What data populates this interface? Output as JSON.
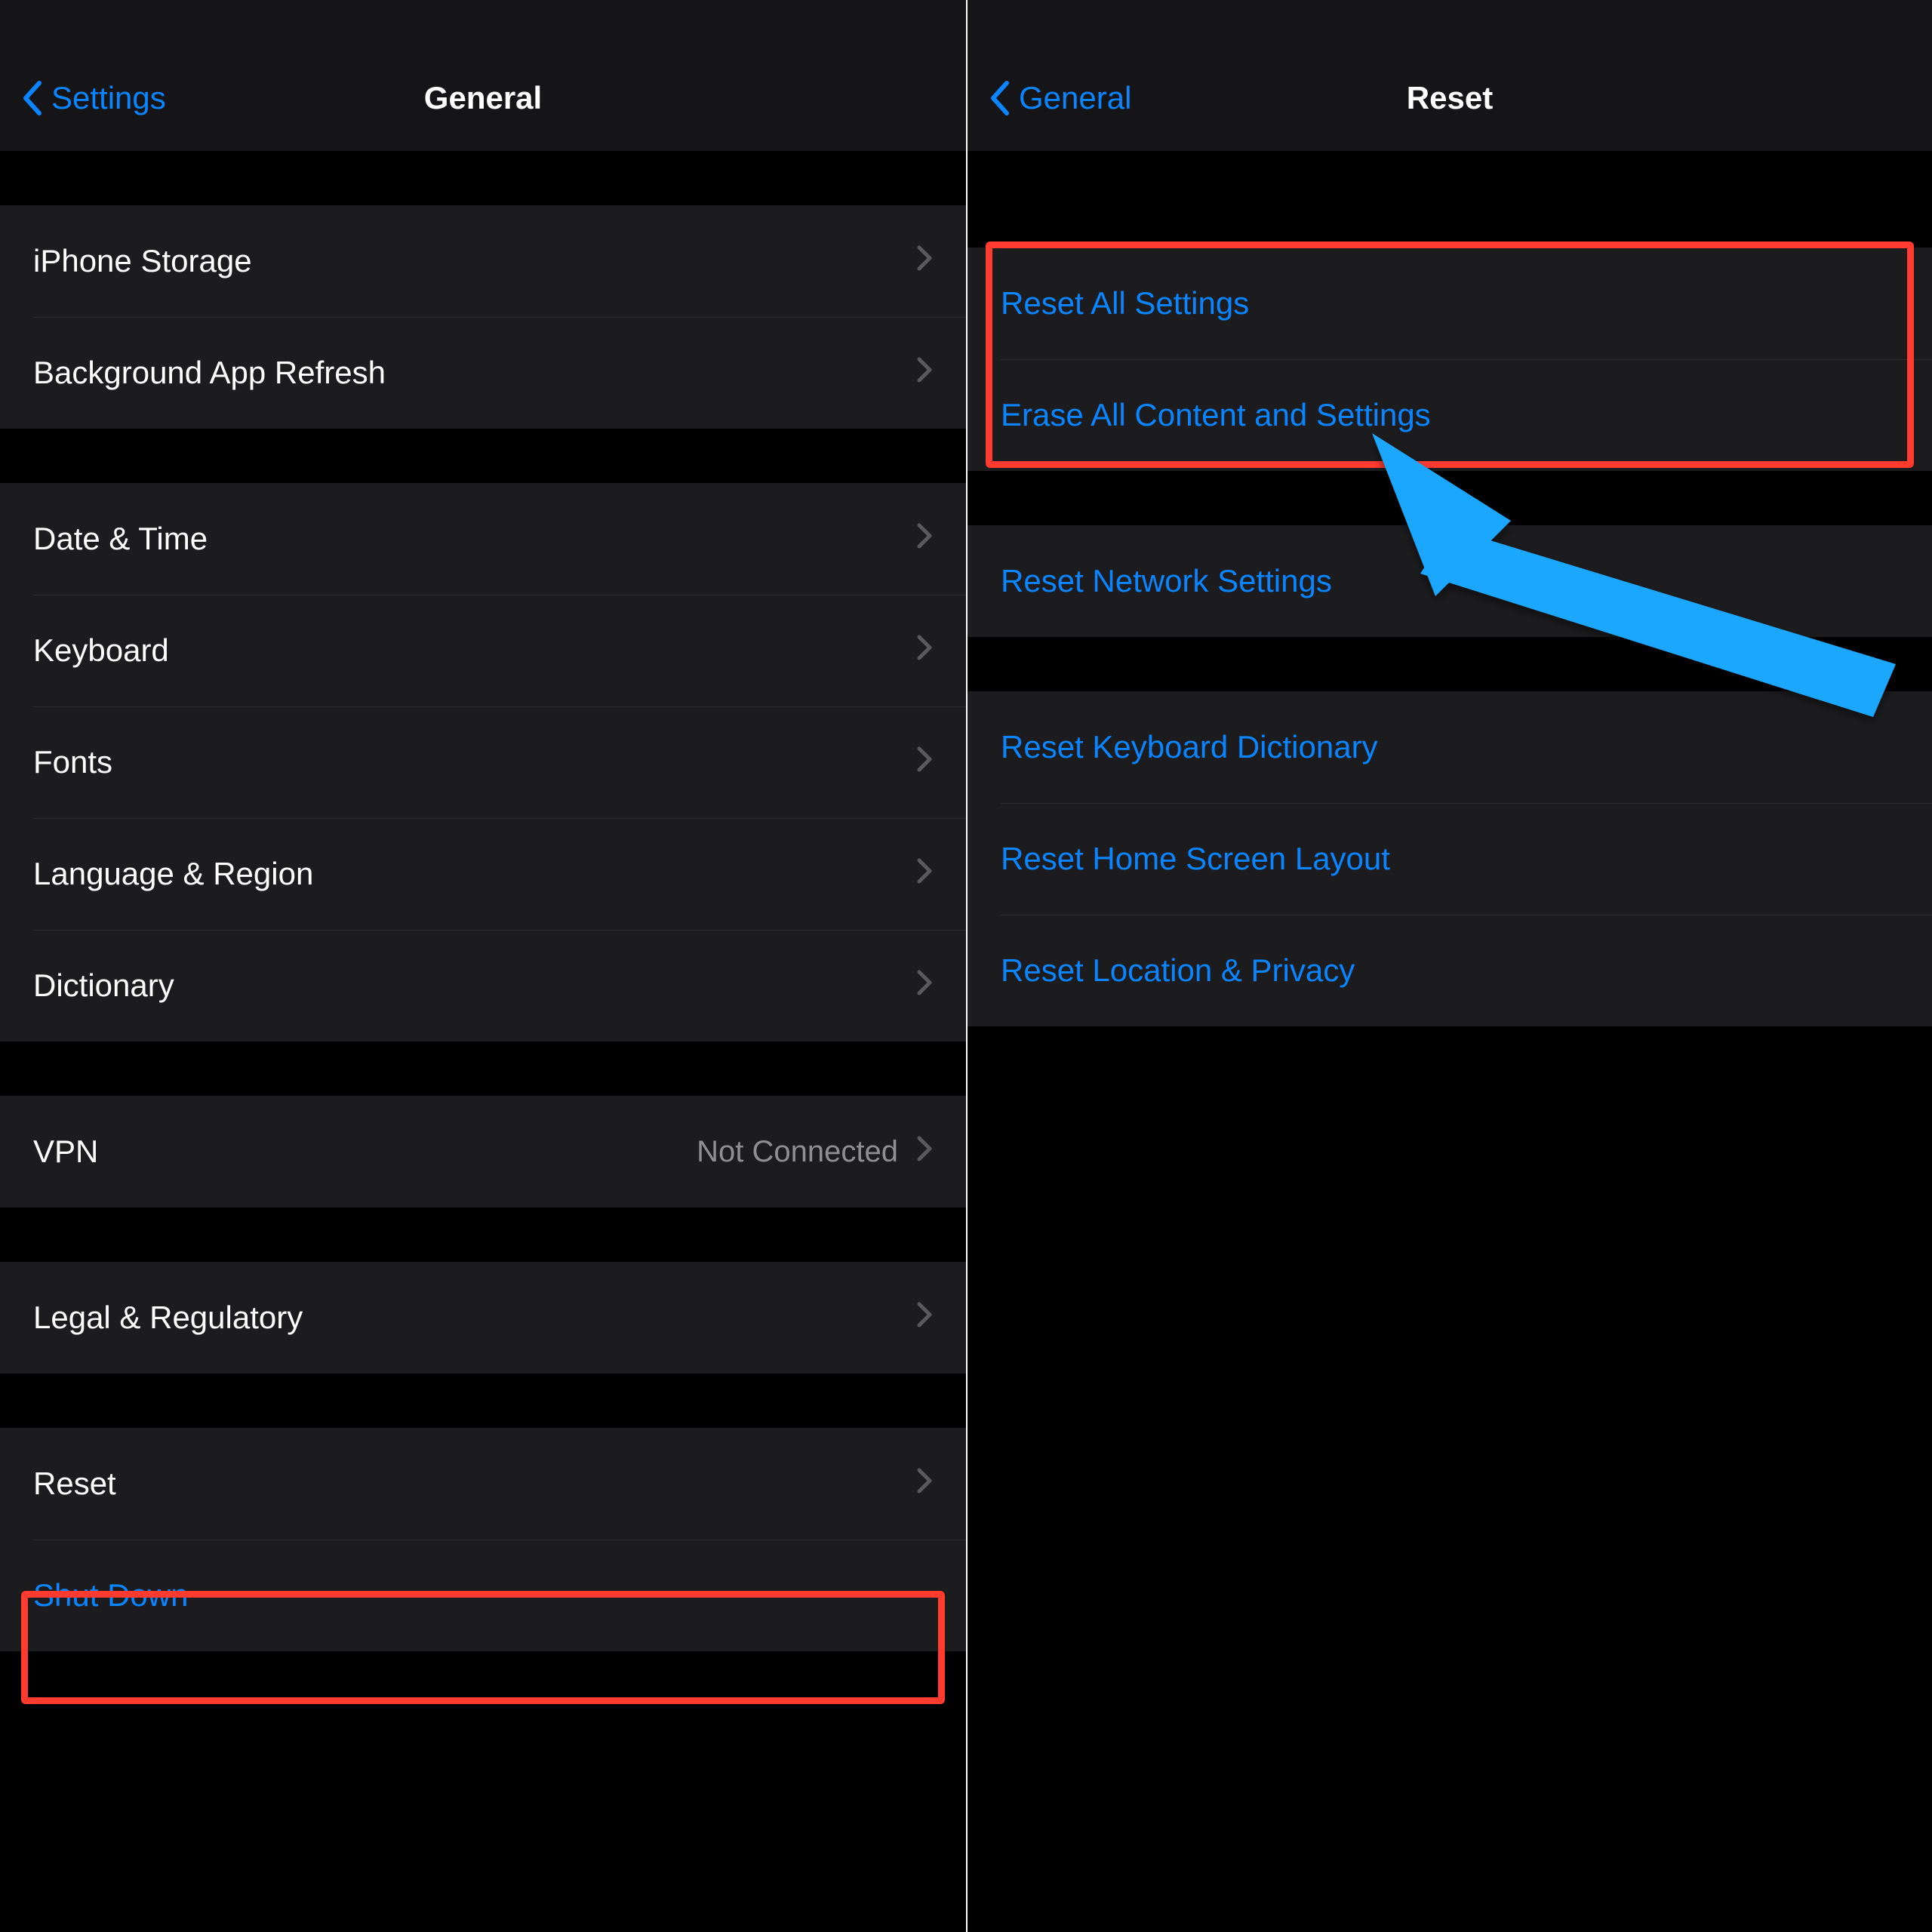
{
  "left": {
    "nav": {
      "back": "Settings",
      "title": "General"
    },
    "rows": {
      "iphone_storage": "iPhone Storage",
      "background_refresh": "Background App Refresh",
      "date_time": "Date & Time",
      "keyboard": "Keyboard",
      "fonts": "Fonts",
      "language_region": "Language & Region",
      "dictionary": "Dictionary",
      "vpn": "VPN",
      "vpn_value": "Not Connected",
      "legal": "Legal & Regulatory",
      "reset": "Reset",
      "shut_down": "Shut Down"
    }
  },
  "right": {
    "nav": {
      "back": "General",
      "title": "Reset"
    },
    "rows": {
      "reset_all": "Reset All Settings",
      "erase_all": "Erase All Content and Settings",
      "reset_network": "Reset Network Settings",
      "reset_keyboard": "Reset Keyboard Dictionary",
      "reset_home": "Reset Home Screen Layout",
      "reset_location": "Reset Location & Privacy"
    }
  }
}
